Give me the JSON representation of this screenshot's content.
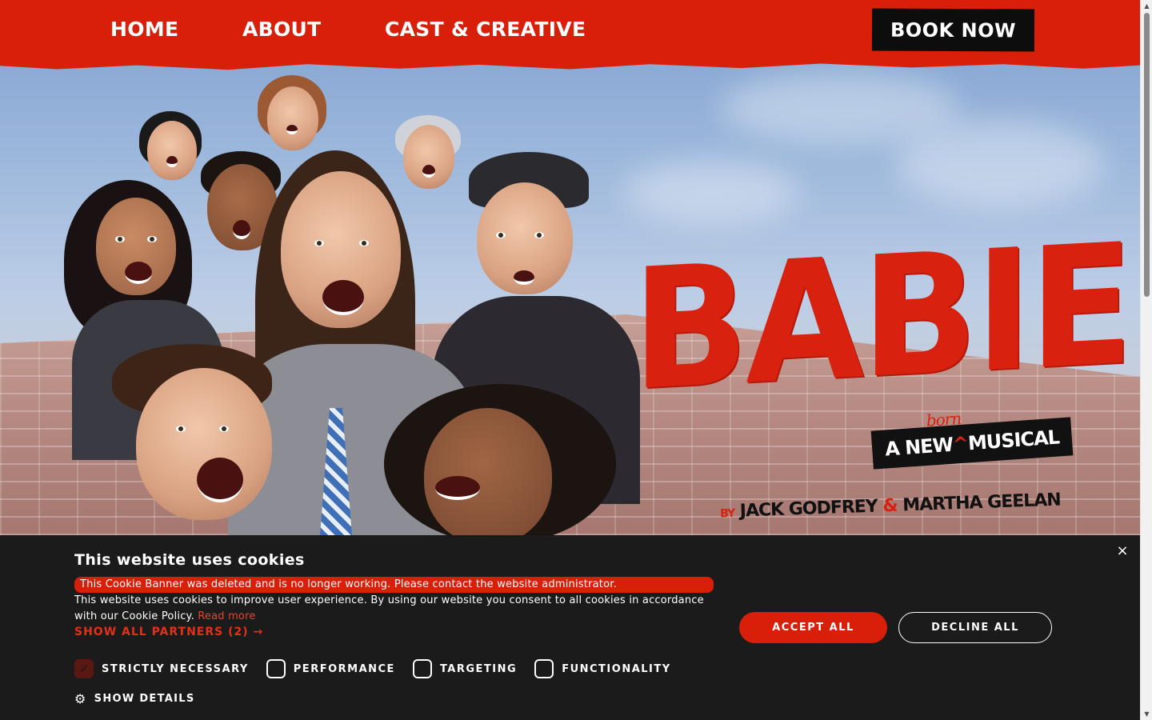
{
  "nav": {
    "items": [
      {
        "label": "HOME"
      },
      {
        "label": "ABOUT"
      },
      {
        "label": "CAST & CREATIVE"
      }
    ],
    "book_label": "BOOK NOW"
  },
  "hero": {
    "title": "BABIES",
    "tagline_a": "A NEW",
    "tagline_insert": "born",
    "tagline_caret": "^",
    "tagline_b": "MUSICAL",
    "by": "BY",
    "author1": "JACK GODFREY",
    "amp": "&",
    "author2": "MARTHA GEELAN"
  },
  "cookie": {
    "title": "This website uses cookies",
    "warning": "This Cookie Banner was deleted and is no longer working. Please contact the website administrator.",
    "body": "This website uses cookies to improve user experience. By using our website you consent to all cookies in accordance with our Cookie Policy.",
    "read_more": "Read more",
    "partners": "SHOW ALL PARTNERS (2) →",
    "checkboxes": [
      {
        "label": "STRICTLY NECESSARY",
        "checked": true
      },
      {
        "label": "PERFORMANCE",
        "checked": false
      },
      {
        "label": "TARGETING",
        "checked": false
      },
      {
        "label": "FUNCTIONALITY",
        "checked": false
      }
    ],
    "show_details": "SHOW DETAILS",
    "accept": "ACCEPT ALL",
    "decline": "DECLINE ALL",
    "close": "×"
  },
  "colors": {
    "brand_red": "#d81f0a",
    "banner_bg": "#1b1b1b"
  }
}
